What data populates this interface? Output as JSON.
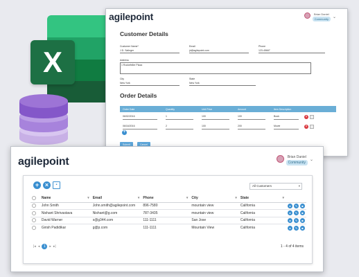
{
  "colors": {
    "excel_dark": "#1d7044",
    "excel_light": "#33c481",
    "excel_mid": "#21a366",
    "excel_deep": "#107c41",
    "db_purple": "#8e63c9",
    "accent_blue": "#3a8fd0",
    "grid_header": "#6aaed6",
    "delete_red": "#d9373e"
  },
  "excel_icon": {
    "letter": "X"
  },
  "form_window": {
    "logo": {
      "text": "agilepoint"
    },
    "user": {
      "name": "Brian Daniel",
      "role": "Community",
      "chevron": "⌄"
    },
    "customer_section": {
      "title": "Customer Details",
      "fields": {
        "customer_name": {
          "label": "Customer Name*",
          "value": "J.D. Salinger"
        },
        "email": {
          "label": "Email",
          "value": "jd@agilepoint.com"
        },
        "phone": {
          "label": "Phone",
          "value": "123-45667"
        },
        "address": {
          "label": "Address",
          "value": "1 Rockefeller Plaza"
        },
        "city": {
          "label": "City",
          "value": "New York"
        },
        "state": {
          "label": "State",
          "value": "New York"
        }
      }
    },
    "order_section": {
      "title": "Order Details",
      "columns": [
        "Order Date",
        "Quantity",
        "Unit Price",
        "Amount",
        "Item Description"
      ],
      "rows": [
        [
          "06/02/2016",
          "1",
          "100",
          "100",
          "Book"
        ],
        [
          "06/16/2016",
          "2",
          "100",
          "200",
          "Movie"
        ]
      ]
    },
    "buttons": {
      "submit": "Submit",
      "cancel": "Cancel"
    }
  },
  "list_window": {
    "logo": {
      "text": "agilepoint"
    },
    "user": {
      "name": "Brian Daniel",
      "role": "Community",
      "chevron": "⌄"
    },
    "filter": {
      "selected": "All Customers"
    },
    "columns": [
      "Name",
      "Email",
      "Phone",
      "City",
      "State"
    ],
    "rows": [
      {
        "name": "John Smith",
        "email": "John.smith@agilepoint.com",
        "phone": "896-7580",
        "city": "mountain view",
        "state": "California"
      },
      {
        "name": "Nishant Shrivastava",
        "email": "Nishant@g.com",
        "phone": "787-3435",
        "city": "mountain view",
        "state": "California"
      },
      {
        "name": "David Warner",
        "email": "s@g344.com",
        "phone": "111-1111",
        "city": "San Jose",
        "state": "California"
      },
      {
        "name": "Girish Padidikar",
        "email": "g@p.com",
        "phone": "111-1111",
        "city": "Mountain View",
        "state": "California"
      }
    ],
    "pager": {
      "current": "1",
      "summary": "1 - 4 of 4 items"
    }
  }
}
